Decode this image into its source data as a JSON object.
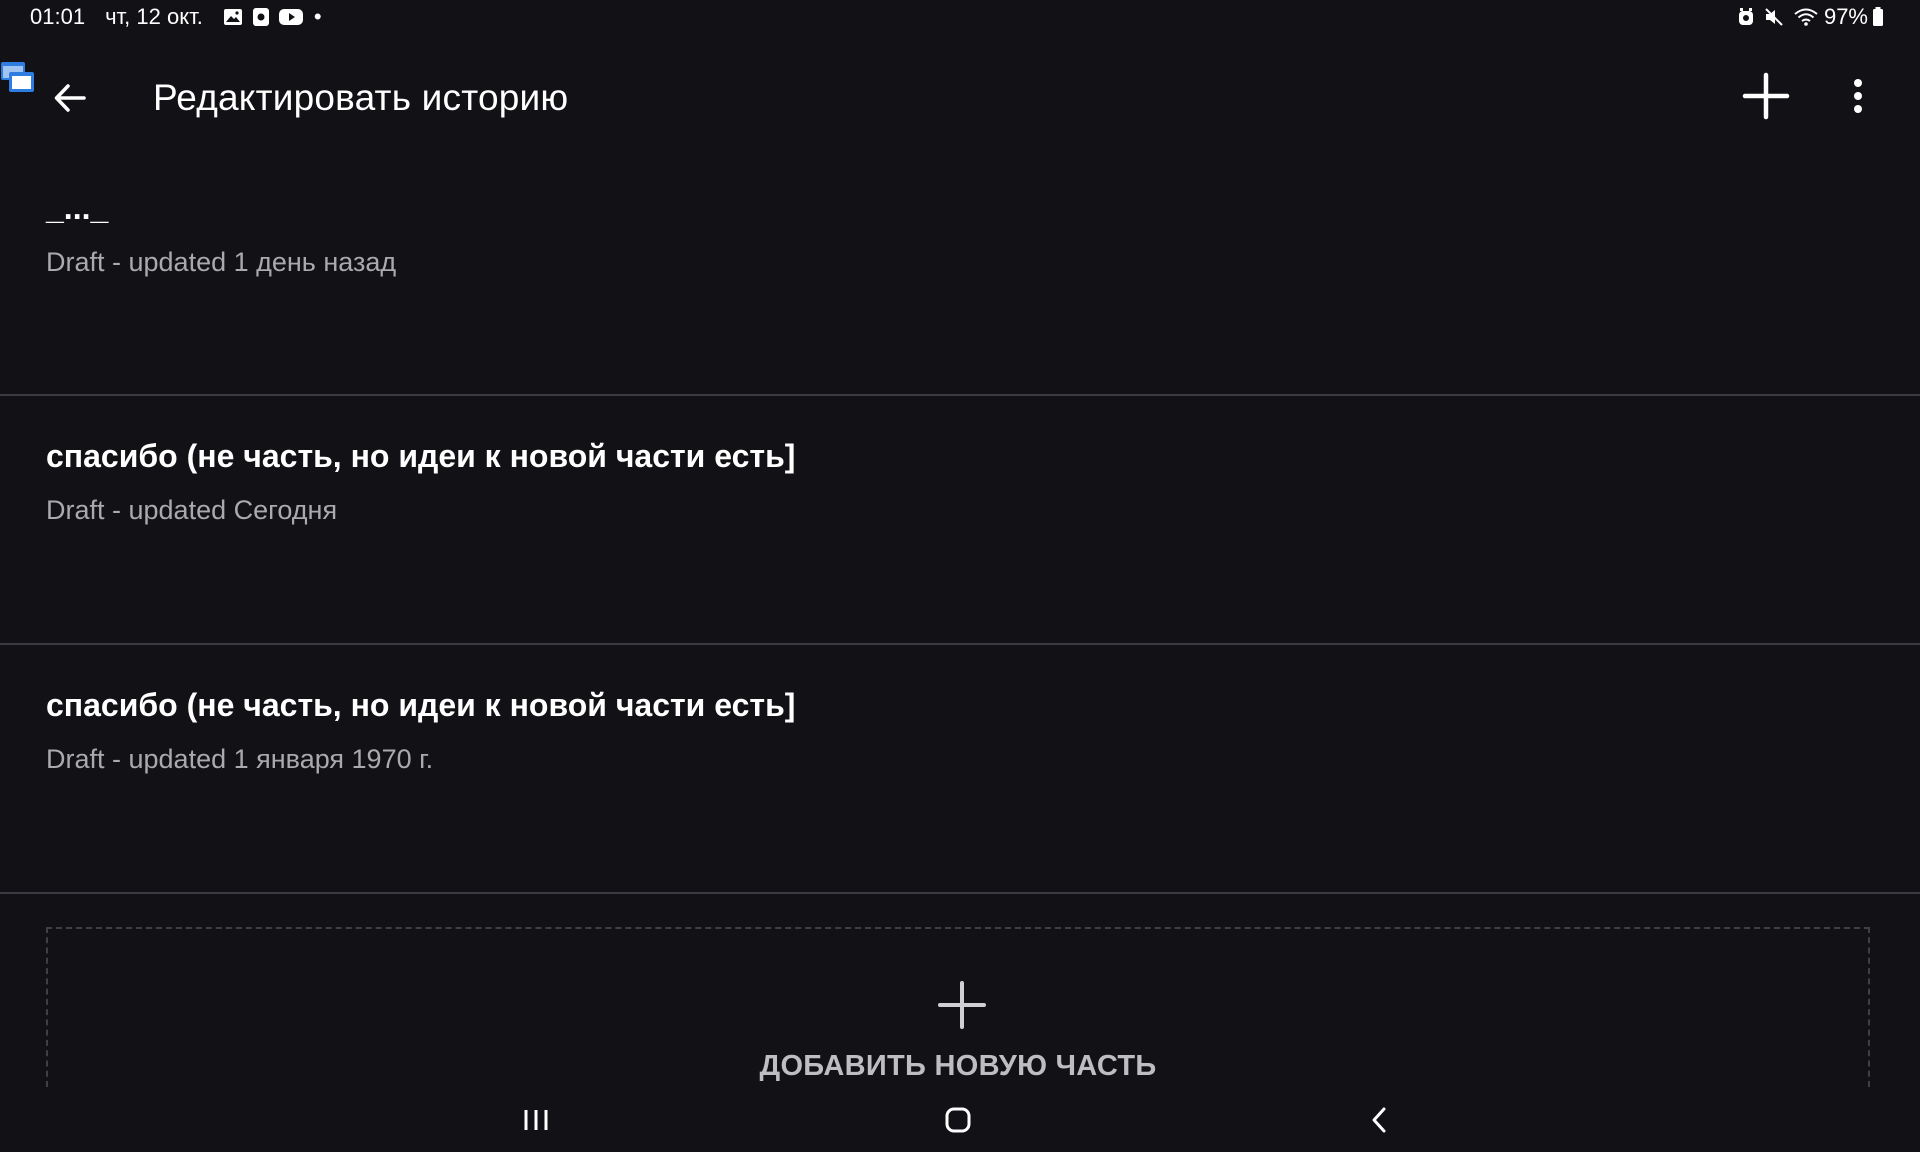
{
  "status_bar": {
    "time": "01:01",
    "date": "чт, 12 окт.",
    "battery": "97%",
    "left_icons": [
      "gallery-icon",
      "screen-recorder-icon",
      "youtube-icon",
      "dot-indicator"
    ],
    "right_icons": [
      "alarm-icon",
      "mute-icon",
      "wifi-icon",
      "battery-icon"
    ],
    "dot": "•"
  },
  "app_bar": {
    "title": "Редактировать историю",
    "back_icon": "arrow-back-icon",
    "add_icon": "plus-icon",
    "menu_icon": "more-vertical-icon"
  },
  "parts": [
    {
      "title": "_..._",
      "meta": "Draft - updated 1 день назад"
    },
    {
      "title": "спасибо (не часть, но идеи к новой части есть]",
      "meta": "Draft - updated Сегодня"
    },
    {
      "title": "спасибо (не часть, но идеи к новой части есть]",
      "meta": "Draft - updated 1 января 1970 г."
    }
  ],
  "add_part": {
    "label": "ДОБАВИТЬ НОВУЮ ЧАСТЬ",
    "icon": "plus-icon"
  },
  "nav_bar": {
    "buttons": [
      "recents-icon",
      "home-icon",
      "back-icon"
    ]
  },
  "colors": {
    "background": "#121116",
    "divider": "#3a3a40",
    "text_primary": "#ffffff",
    "text_secondary": "#a9a9ae",
    "accent_badge": "#2f7de1"
  }
}
